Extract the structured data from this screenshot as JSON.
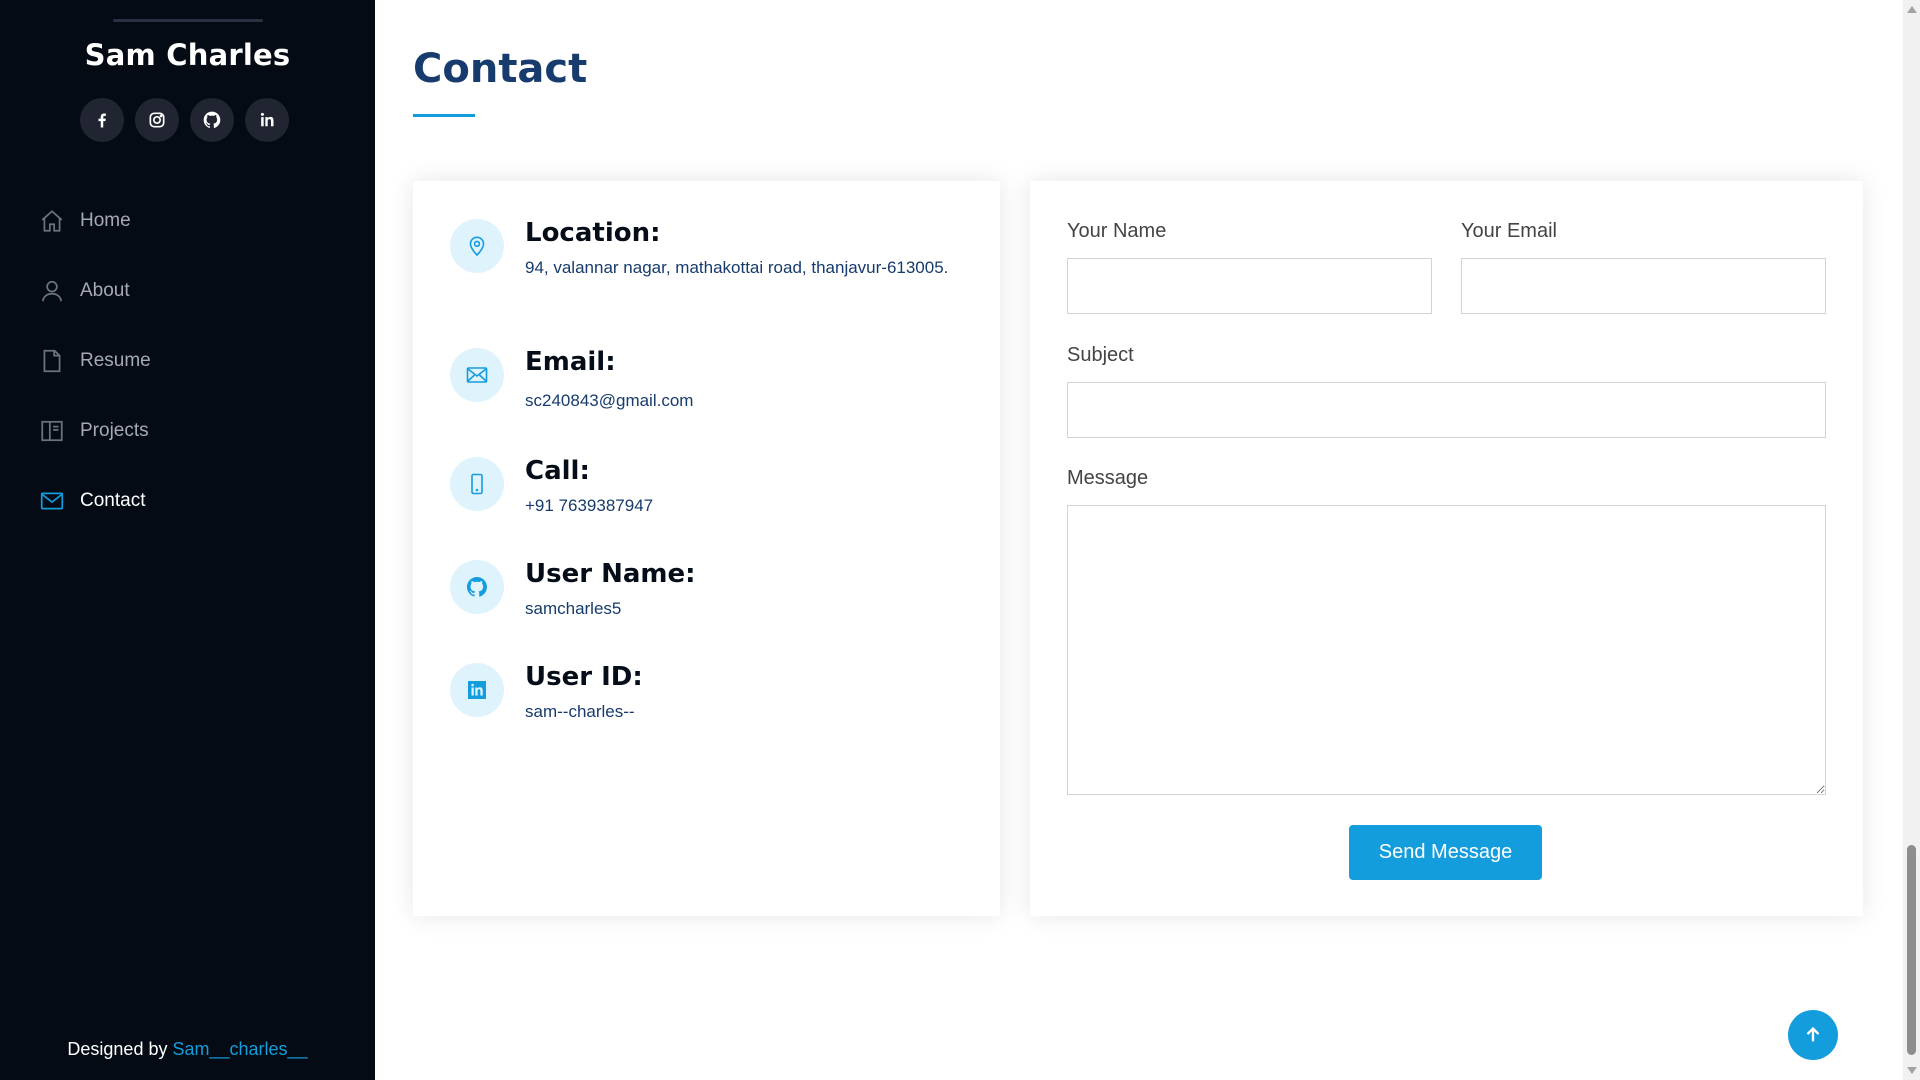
{
  "sidebar": {
    "name": "Sam Charles",
    "social": [
      {
        "icon": "facebook-icon"
      },
      {
        "icon": "instagram-icon"
      },
      {
        "icon": "github-icon"
      },
      {
        "icon": "linkedin-icon"
      }
    ],
    "nav": [
      {
        "label": "Home",
        "icon": "home-icon"
      },
      {
        "label": "About",
        "icon": "user-icon"
      },
      {
        "label": "Resume",
        "icon": "file-icon"
      },
      {
        "label": "Projects",
        "icon": "book-icon"
      },
      {
        "label": "Contact",
        "icon": "envelope-icon",
        "active": true
      }
    ],
    "footer": {
      "prefix": "Designed by ",
      "link": "Sam__charles__"
    }
  },
  "main": {
    "title": "Contact",
    "info": [
      {
        "heading": "Location:",
        "text": "94, valannar nagar, mathakottai road, thanjavur-613005.",
        "icon": "location-pin-icon"
      },
      {
        "heading": "Email:",
        "text": "sc240843@gmail.com",
        "icon": "envelope-icon"
      },
      {
        "heading": "Call:",
        "text": "+91 7639387947",
        "icon": "phone-icon"
      },
      {
        "heading": "User Name:",
        "text": "samcharles5",
        "icon": "github-icon"
      },
      {
        "heading": "User ID:",
        "text": "sam--charles--",
        "icon": "linkedin-icon"
      }
    ],
    "form": {
      "name_label": "Your Name",
      "name_value": "",
      "email_label": "Your Email",
      "email_value": "",
      "subject_label": "Subject",
      "subject_value": "",
      "message_label": "Message",
      "message_value": "",
      "submit_label": "Send Message"
    }
  },
  "colors": {
    "sidebar_bg": "#040b14",
    "accent": "#149ddd",
    "title": "#173b6c"
  }
}
